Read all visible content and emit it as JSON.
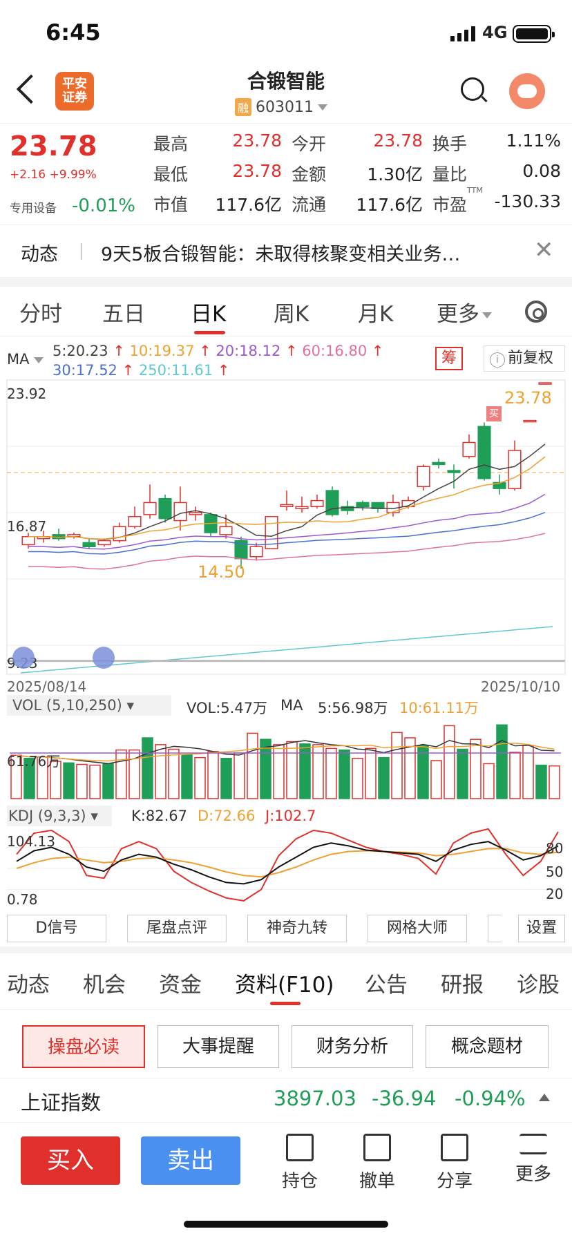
{
  "status": {
    "time": "6:45",
    "network": "4G"
  },
  "header": {
    "logo_line1": "平安",
    "logo_line2": "证券",
    "title": "合锻智能",
    "badge": "融",
    "code": "603011"
  },
  "quote": {
    "price": "23.78",
    "change": "+2.16 +9.99%",
    "device_label": "专用设备",
    "device_change": "-0.01%",
    "rows": [
      [
        {
          "l": "最高",
          "v": "23.78",
          "c": "red"
        },
        {
          "l": "今开",
          "v": "23.78",
          "c": "red"
        },
        {
          "l": "换手",
          "v": "1.11%",
          "c": "plain"
        }
      ],
      [
        {
          "l": "最低",
          "v": "23.78",
          "c": "red"
        },
        {
          "l": "金额",
          "v": "1.30亿",
          "c": "plain"
        },
        {
          "l": "量比",
          "v": "0.08",
          "c": "plain"
        }
      ],
      [
        {
          "l": "市值",
          "v": "117.6亿",
          "c": "plain"
        },
        {
          "l": "流通",
          "v": "117.6亿",
          "c": "plain"
        },
        {
          "l": "市盈",
          "v": "-130.33",
          "c": "plain"
        }
      ]
    ],
    "ttm": "TTM"
  },
  "news": {
    "tag": "动态",
    "text": "9天5板合锻智能：未取得核聚变相关业务…"
  },
  "tabs": [
    "分时",
    "五日",
    "日K",
    "周K",
    "月K",
    "更多"
  ],
  "ma": {
    "label": "MA",
    "items": [
      {
        "t": "5:20.23",
        "c": "#444"
      },
      {
        "t": "10:19.37",
        "c": "#f0a030"
      },
      {
        "t": "20:18.12",
        "c": "#9b59d0"
      },
      {
        "t": "60:16.80",
        "c": "#e070a0"
      },
      {
        "t": "30:17.52",
        "c": "#4a6fd0"
      },
      {
        "t": "250:11.61",
        "c": "#60c8d0"
      }
    ],
    "chou": "筹",
    "fuquan": "前复权"
  },
  "main_chart": {
    "y_top": "23.92",
    "y_mid": "16.87",
    "y_bottom": "9.23",
    "x_start": "2025/08/14",
    "x_end": "2025/10/10",
    "high_label": "23.78",
    "low_label": "14.50",
    "buy_mark": "买"
  },
  "chart_data": {
    "type": "candlestick",
    "x_start": "2025/08/14",
    "x_end": "2025/10/10",
    "candles": [
      [
        15.7,
        16.1,
        15.5,
        16.3
      ],
      [
        16.0,
        16.1,
        15.8,
        16.4
      ],
      [
        16.2,
        16.0,
        15.9,
        16.5
      ],
      [
        16.1,
        16.2,
        16.0,
        16.3
      ],
      [
        15.8,
        15.6,
        15.5,
        16.0
      ],
      [
        15.7,
        15.9,
        15.6,
        16.0
      ],
      [
        15.9,
        16.6,
        15.8,
        16.8
      ],
      [
        16.6,
        17.1,
        16.5,
        17.6
      ],
      [
        17.2,
        17.8,
        17.0,
        18.7
      ],
      [
        18.0,
        17.0,
        16.8,
        18.2
      ],
      [
        16.9,
        17.8,
        16.4,
        18.6
      ],
      [
        17.2,
        17.3,
        16.9,
        17.6
      ],
      [
        17.2,
        16.3,
        16.1,
        17.3
      ],
      [
        16.2,
        16.6,
        16.0,
        17.2
      ],
      [
        15.9,
        15.0,
        14.5,
        16.1
      ],
      [
        15.1,
        15.6,
        14.9,
        15.8
      ],
      [
        15.5,
        17.1,
        15.5,
        17.1
      ],
      [
        17.6,
        17.7,
        17.4,
        18.4
      ],
      [
        17.5,
        17.6,
        17.3,
        18.1
      ],
      [
        17.6,
        17.9,
        17.5,
        18.2
      ],
      [
        18.4,
        17.2,
        17.1,
        18.6
      ],
      [
        17.6,
        17.4,
        17.2,
        17.9
      ],
      [
        17.8,
        17.6,
        17.4,
        17.9
      ],
      [
        17.8,
        17.5,
        17.3,
        17.8
      ],
      [
        17.3,
        17.8,
        17.1,
        18.2
      ],
      [
        17.6,
        17.9,
        17.5,
        18.1
      ],
      [
        18.6,
        19.6,
        18.4,
        19.7
      ],
      [
        19.8,
        19.7,
        19.5,
        20.0
      ],
      [
        19.4,
        19.3,
        18.5,
        19.7
      ],
      [
        20.1,
        20.8,
        20.0,
        21.2
      ],
      [
        21.6,
        19.0,
        18.9,
        21.8
      ],
      [
        18.8,
        18.5,
        18.2,
        19.2
      ],
      [
        18.5,
        20.4,
        18.4,
        20.9
      ],
      [
        21.9,
        21.9,
        21.9,
        21.9
      ],
      [
        23.78,
        23.78,
        23.78,
        23.78
      ]
    ],
    "volume_series": [
      {
        "name": "VOL",
        "values": [
          5.7,
          5.3,
          5.5,
          4.9,
          4.7,
          4.5,
          4.4,
          4.6,
          6.4,
          6.4,
          8.0,
          7.1,
          6.5,
          5.8,
          5.4,
          6.2,
          5.3,
          6.0,
          8.6,
          7.8,
          7.1,
          7.5,
          7.2,
          7.1,
          6.6,
          6.4,
          5.3,
          6.6,
          5.4,
          8.7,
          8.0,
          7.0,
          5.0,
          9.6,
          6.5,
          7.8,
          4.6,
          9.7,
          6.1,
          7.0,
          4.4,
          4.3
        ]
      }
    ],
    "volume_labels": {
      "vol": "VOL:5.47万",
      "ma5": "5:56.98万",
      "ma10": "10:61.11万",
      "y_label": "61.76万",
      "title": "VOL (5,10,250)"
    },
    "kdj": {
      "title": "KDJ (9,3,3)",
      "K": "K:82.67",
      "D": "D:72.66",
      "J": "J:102.7",
      "y_top": "104.13",
      "y_bottom": "0.78",
      "levels": [
        "80",
        "50",
        "20"
      ]
    }
  },
  "tools": [
    "D信号",
    "尾盘点评",
    "神奇九转",
    "网格大师",
    "设置"
  ],
  "ftabs": [
    "动态",
    "机会",
    "资金",
    "资料(F10)",
    "公告",
    "研报",
    "诊股"
  ],
  "subtabs": [
    "操盘必读",
    "大事提醒",
    "财务分析",
    "概念题材"
  ],
  "index": {
    "name": "上证指数",
    "value": "3897.03",
    "change": "-36.94",
    "pct": "-0.94%"
  },
  "bottom": {
    "buy": "买入",
    "sell": "卖出",
    "actions": [
      "持仓",
      "撤单",
      "分享",
      "更多"
    ]
  },
  "colors": {
    "up": "#e0302c",
    "down": "#1f9e57",
    "accent": "#e0302c"
  }
}
